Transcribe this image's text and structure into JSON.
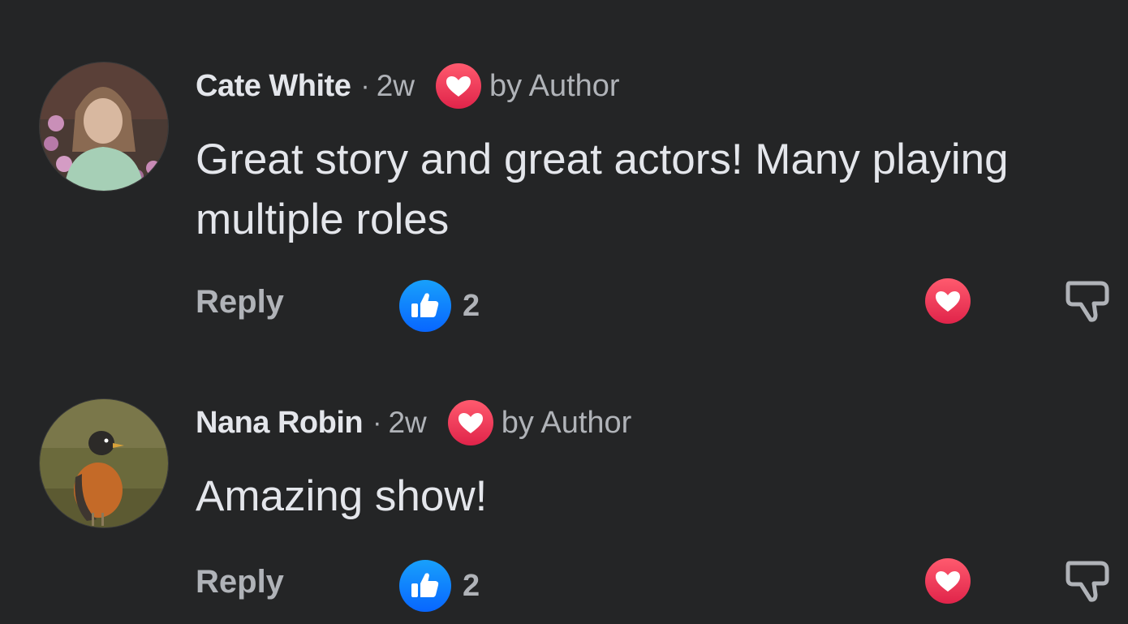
{
  "colors": {
    "background": "#242526",
    "primary_text": "#e4e6eb",
    "secondary_text": "#b0b3b8",
    "heart_red": "#f33e58",
    "like_blue": "#1877f2"
  },
  "icons": {
    "heart": "heart-icon",
    "like": "thumbs-up-icon",
    "dislike": "thumbs-down-icon"
  },
  "comments": [
    {
      "author": "Cate White",
      "separator": "·",
      "time": "2w",
      "badge_label": "by Author",
      "text": "Great story and great actors! Many playing multiple roles",
      "reply_label": "Reply",
      "like_count": "2"
    },
    {
      "author": "Nana Robin",
      "separator": "·",
      "time": "2w",
      "badge_label": "by Author",
      "text": "Amazing show!",
      "reply_label": "Reply",
      "like_count": "2"
    }
  ]
}
